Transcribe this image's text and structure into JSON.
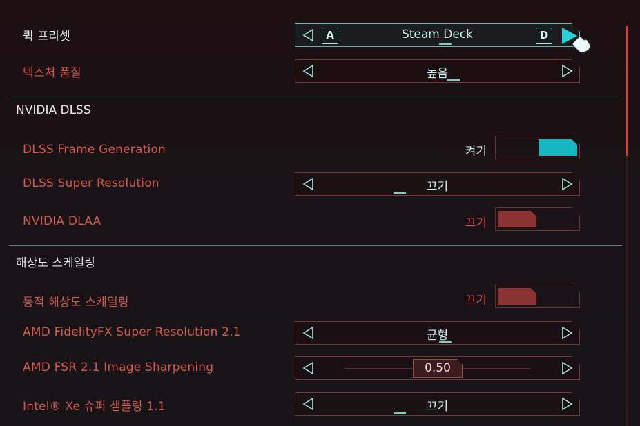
{
  "settings": {
    "quick_preset": {
      "label": "퀵 프리셋",
      "value": "Steam Deck",
      "key_left": "A",
      "key_right": "D"
    },
    "texture_quality": {
      "label": "텍스처 품질",
      "value": "높음"
    },
    "section_dlss": "NVIDIA DLSS",
    "dlss_frame_generation": {
      "label": "DLSS Frame Generation",
      "state": "켜기"
    },
    "dlss_super_resolution": {
      "label": "DLSS Super Resolution",
      "value": "끄기"
    },
    "nvidia_dlaa": {
      "label": "NVIDIA DLAA",
      "state": "끄기"
    },
    "section_scaling": "해상도 스케일링",
    "dynamic_resolution": {
      "label": "동적 해상도 스케일링",
      "state": "끄기"
    },
    "amd_fsr": {
      "label": "AMD FidelityFX Super Resolution 2.1",
      "value": "균형"
    },
    "amd_fsr_sharpening": {
      "label": "AMD FSR 2.1 Image Sharpening",
      "value": "0.50",
      "fraction": 0.5
    },
    "intel_xe": {
      "label": "Intel® Xe 슈퍼 샘플링 1.1",
      "value": "끄기"
    }
  },
  "colors": {
    "accent_cyan": "#14b6c1",
    "label_red": "#d2594f",
    "off_knob": "#8b3333",
    "divider": "#3d8f8a"
  },
  "icons": {
    "left_arrow": "left-triangle-outline",
    "right_arrow": "right-triangle-outline",
    "cursor": "hand-pointer"
  }
}
